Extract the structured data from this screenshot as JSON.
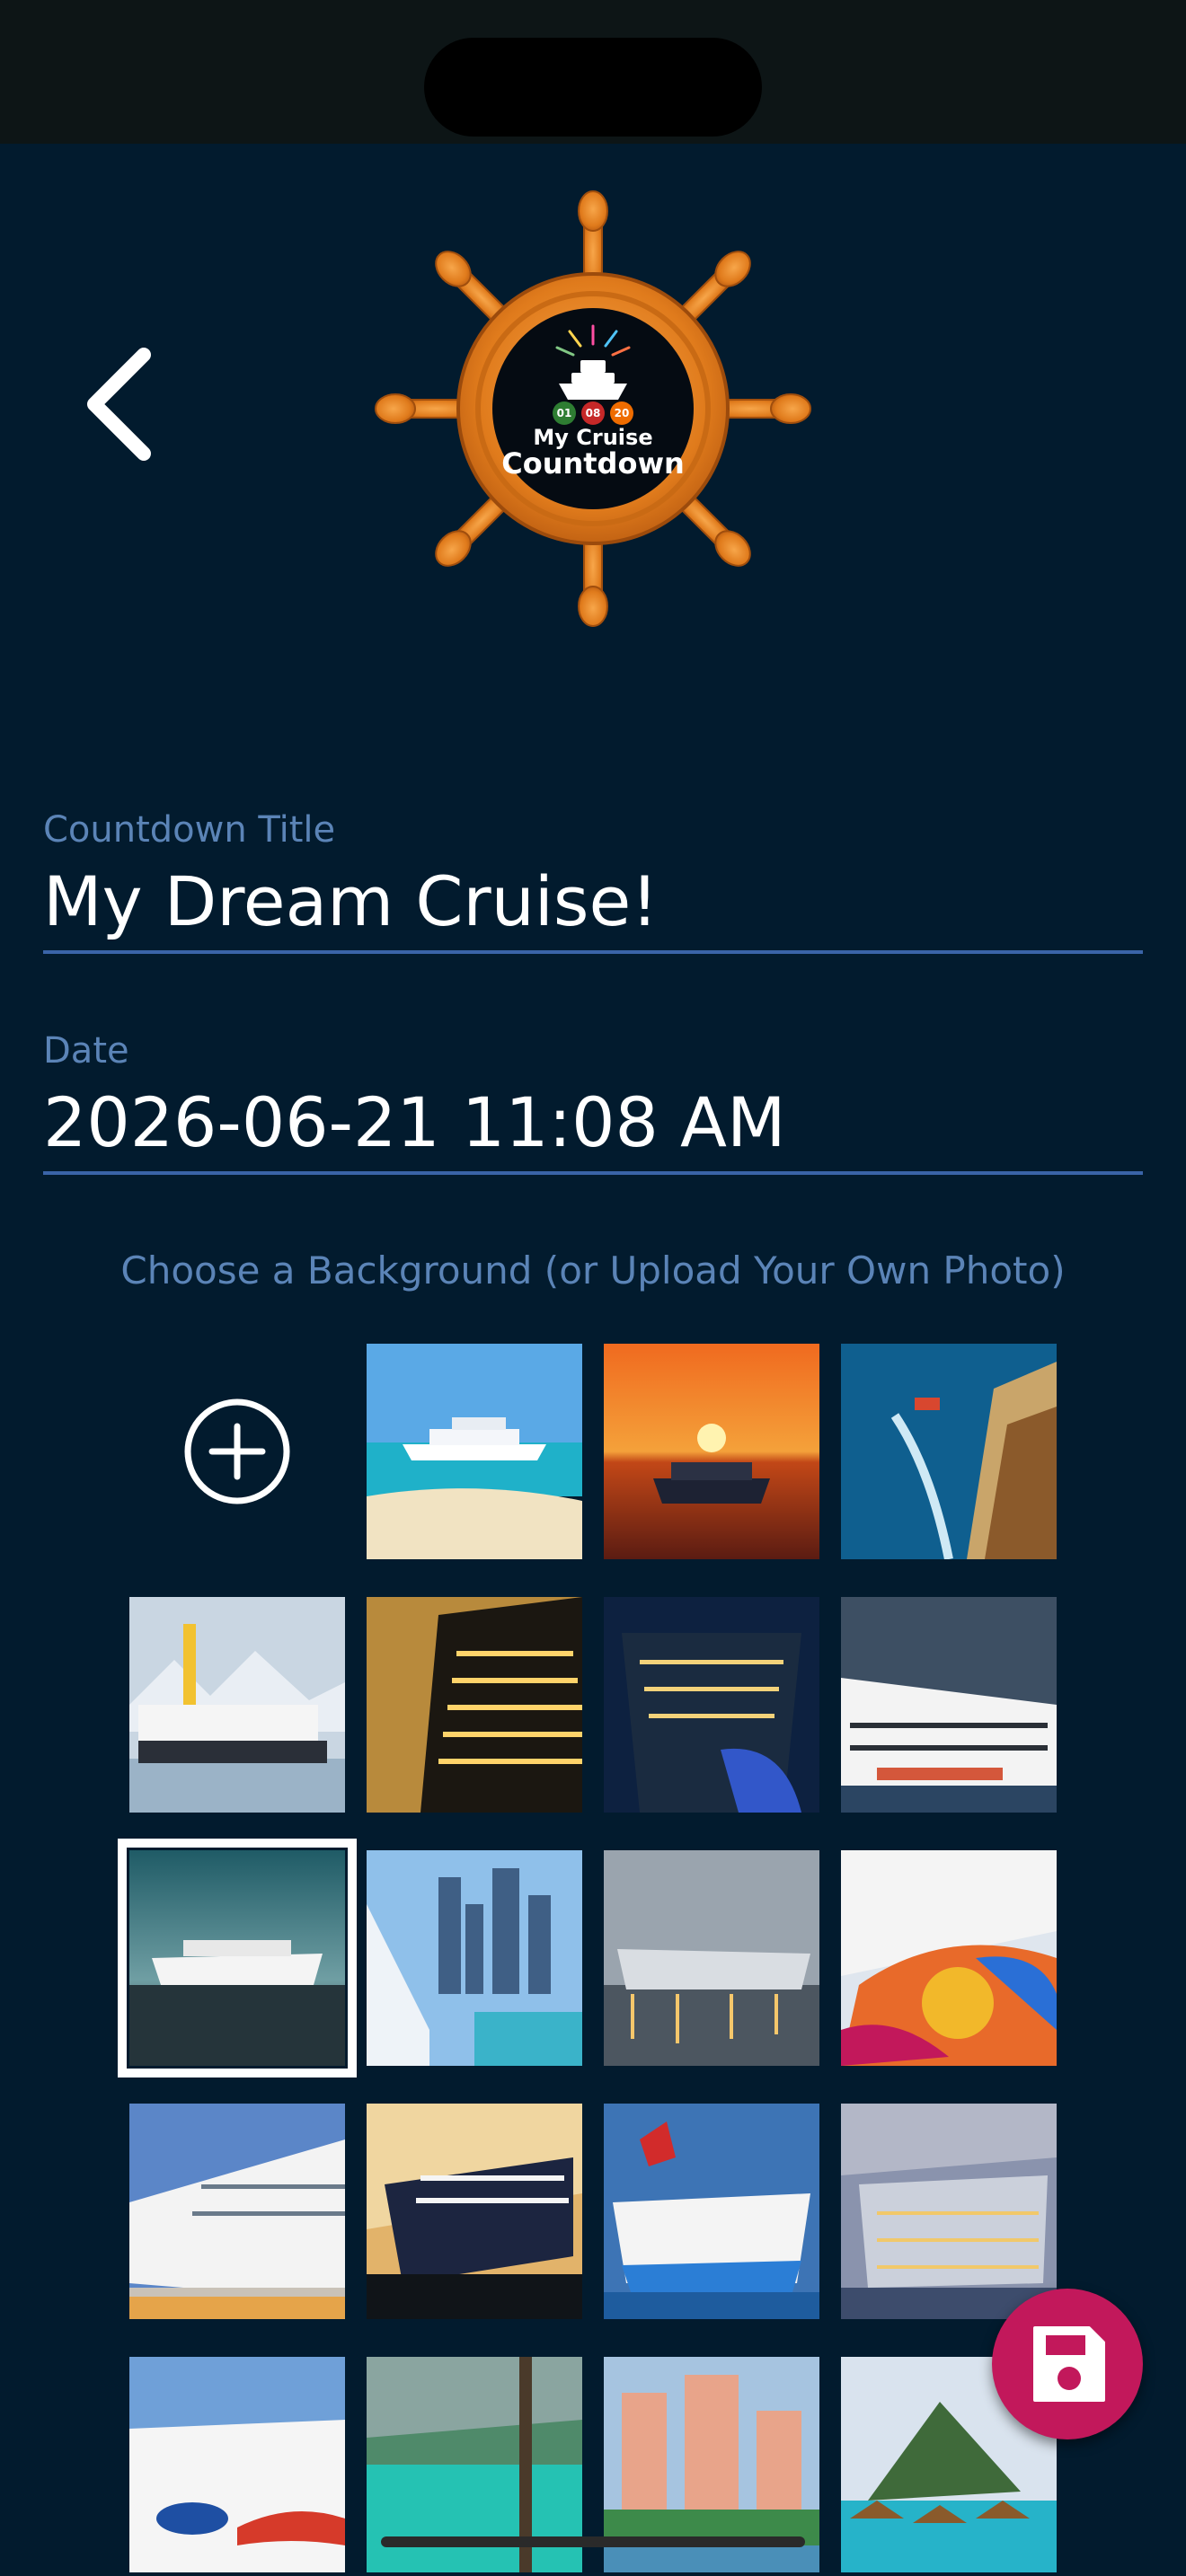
{
  "header": {
    "back_icon": "chevron-left-icon",
    "logo": {
      "date_digits": [
        "01",
        "08",
        "20"
      ],
      "line1": "My Cruise",
      "line2": "Countdown"
    }
  },
  "form": {
    "title": {
      "label": "Countdown Title",
      "value": "My Dream Cruise!"
    },
    "date": {
      "label": "Date",
      "value": "2026-06-21 11:08 AM"
    }
  },
  "backgrounds": {
    "heading": "Choose a Background (or Upload Your Own Photo)",
    "upload_icon": "plus-circle-icon",
    "selected_index": 7,
    "images": [
      {
        "name": "ship-at-beach"
      },
      {
        "name": "ship-at-sunset"
      },
      {
        "name": "ship-aerial-wake"
      },
      {
        "name": "paddle-steamer-mountains"
      },
      {
        "name": "ship-stern-night-gold"
      },
      {
        "name": "ship-bow-night"
      },
      {
        "name": "ship-in-fjord"
      },
      {
        "name": "msc-ship-at-sea"
      },
      {
        "name": "city-skyline-deck"
      },
      {
        "name": "ship-evening-lights"
      },
      {
        "name": "ship-colorful-hull-art"
      },
      {
        "name": "ship-docked-pier"
      },
      {
        "name": "ship-dark-hull-sunset"
      },
      {
        "name": "carnival-ship-blue"
      },
      {
        "name": "ship-dusk-port"
      },
      {
        "name": "aida-ship-face"
      },
      {
        "name": "turquoise-lake-trees"
      },
      {
        "name": "resort-towers"
      },
      {
        "name": "overwater-bungalows-island"
      }
    ]
  },
  "actions": {
    "save_icon": "save-icon"
  },
  "colors": {
    "background": "#021b2e",
    "status_bar": "#0d1516",
    "label": "#5b84b7",
    "underline": "#3a64a8",
    "fab": "#c2185b"
  }
}
